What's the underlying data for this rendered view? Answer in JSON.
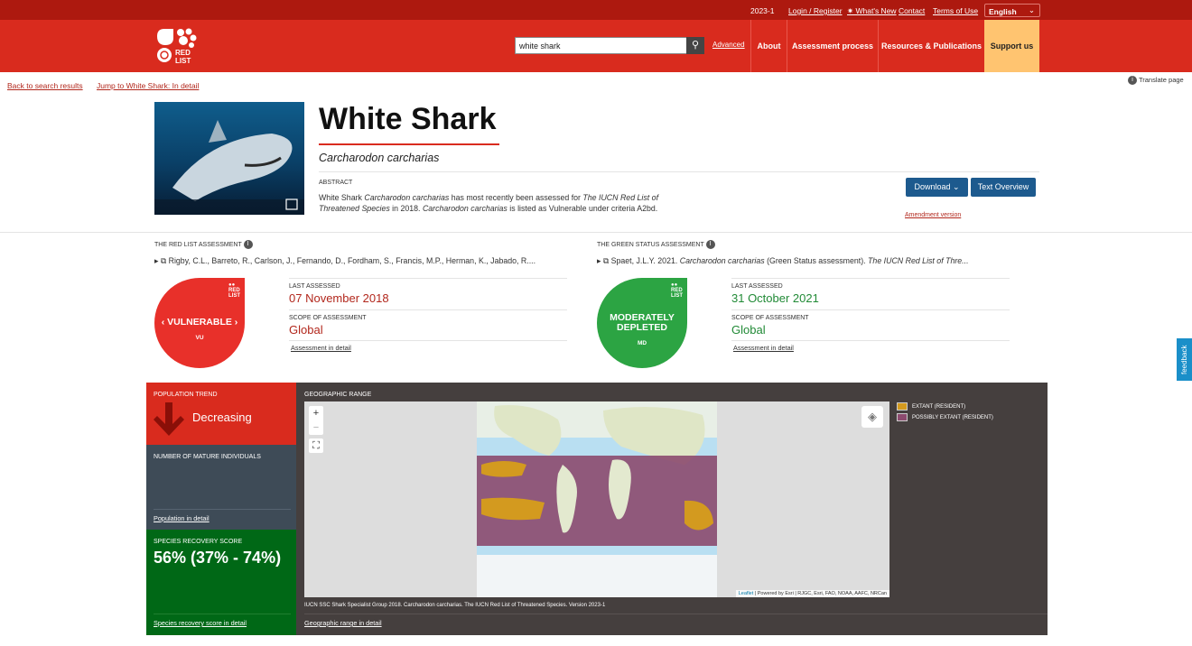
{
  "topbar": {
    "version": "2023-1",
    "login": "Login / Register",
    "whats_new": "✷ What's New",
    "contact": "Contact",
    "terms": "Terms of Use",
    "language": "English"
  },
  "header": {
    "logo_text": "RED LIST",
    "search_value": "white shark",
    "advanced": "Advanced",
    "nav": [
      "About",
      "Assessment process",
      "Resources & Publications",
      "Support us"
    ]
  },
  "breadcrumbs": {
    "back": "Back to search results",
    "jump": "Jump to White Shark: In detail",
    "translate": "Translate page"
  },
  "species": {
    "common_name": "White Shark",
    "scientific_name": "Carcharodon carcharias",
    "abstract_label": "ABSTRACT",
    "abstract_parts": [
      "White Shark ",
      "Carcharodon carcharias",
      " has most recently been assessed for ",
      "The IUCN Red List of Threatened Species",
      " in 2018. ",
      "Carcharodon carcharias",
      " is listed as Vulnerable under criteria A2bd."
    ],
    "download": "Download",
    "text_overview": "Text Overview",
    "amendment": "Amendment version"
  },
  "red_list": {
    "heading": "THE RED LIST ASSESSMENT",
    "citation": "Rigby, C.L., Barreto, R., Carlson, J., Fernando, D., Fordham, S., Francis, M.P., Herman, K., Jabado, R....",
    "category": "VULNERABLE",
    "code": "VU",
    "last_assessed_label": "LAST ASSESSED",
    "last_assessed": "07 November 2018",
    "scope_label": "SCOPE OF ASSESSMENT",
    "scope": "Global",
    "detail_link": "Assessment in detail",
    "color": "#e8302a",
    "text_color": "#b2271c"
  },
  "green_status": {
    "heading": "THE GREEN STATUS ASSESSMENT",
    "citation_parts": [
      "Spaet, J.L.Y. 2021. ",
      "Carcharodon carcharias",
      " (Green Status assessment). ",
      "The IUCN Red List of Thre..."
    ],
    "category_line1": "MODERATELY",
    "category_line2": "DEPLETED",
    "code": "MD",
    "last_assessed_label": "LAST ASSESSED",
    "last_assessed": "31 October 2021",
    "scope_label": "SCOPE OF ASSESSMENT",
    "scope": "Global",
    "detail_link": "Assessment in detail",
    "color": "#2ca443",
    "text_color": "#218a36"
  },
  "population": {
    "trend_label": "POPULATION TREND",
    "trend": "Decreasing",
    "mature_label": "NUMBER OF MATURE INDIVIDUALS",
    "population_link": "Population in detail",
    "recovery_label": "SPECIES RECOVERY SCORE",
    "recovery_score": "56% (37% - 74%)",
    "recovery_link": "Species recovery score in detail"
  },
  "range": {
    "heading": "GEOGRAPHIC RANGE",
    "zoom_in": "+",
    "zoom_out": "−",
    "attribution_leaflet": "Leaflet",
    "attribution_rest": " | Powered by Esri | RJGC, Esri, FAO, NOAA, AAFC, NRCan",
    "citation": "IUCN SSC Shark Specialist Group 2018. Carcharodon carcharias. The IUCN Red List of Threatened Species. Version 2023-1",
    "detail_link": "Geographic range in detail",
    "legend": [
      {
        "label": "EXTANT (RESIDENT)",
        "color": "#d39a1f"
      },
      {
        "label": "POSSIBLY EXTANT (RESIDENT)",
        "color": "#8c4a6e"
      }
    ]
  },
  "feedback": "feedback"
}
